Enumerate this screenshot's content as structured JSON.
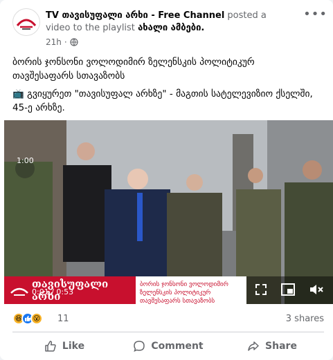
{
  "post": {
    "page_name": "TV თავისუფალი არხი - Free Channel",
    "action_text": "posted a video to the playlist",
    "playlist": "ახალი ამბები.",
    "time": "21h",
    "audience_icon": "globe-icon",
    "line1": "ბორის ჯონსონი ვოლოდიმირ ზელენსკის პოლიტიკურ თავშესაფარს სთავაზობს",
    "line2": "📺 გვიყურეთ \"თავისუფალ არხზე\" - მაგთის სატელევიზიო ქსელში, 45-ე არხზე."
  },
  "video": {
    "overlay_time": "1:00",
    "timer": "0:01 / 0:53",
    "brand": "თავისუფალი არხი",
    "ticker": "ბორის ჯონსონი ვოლოდიმირ ზელენსკის პოლიტიკურ თავშესაფარს სთავაზობს"
  },
  "reactions": {
    "count": "11",
    "shares": "3 shares",
    "icons": [
      "haha-icon",
      "like-icon",
      "wow-icon"
    ]
  },
  "actions": {
    "like": "Like",
    "comment": "Comment",
    "share": "Share"
  },
  "colors": {
    "brand_red": "#c8102e",
    "muted": "#65676b",
    "like_blue": "#1877f2"
  }
}
